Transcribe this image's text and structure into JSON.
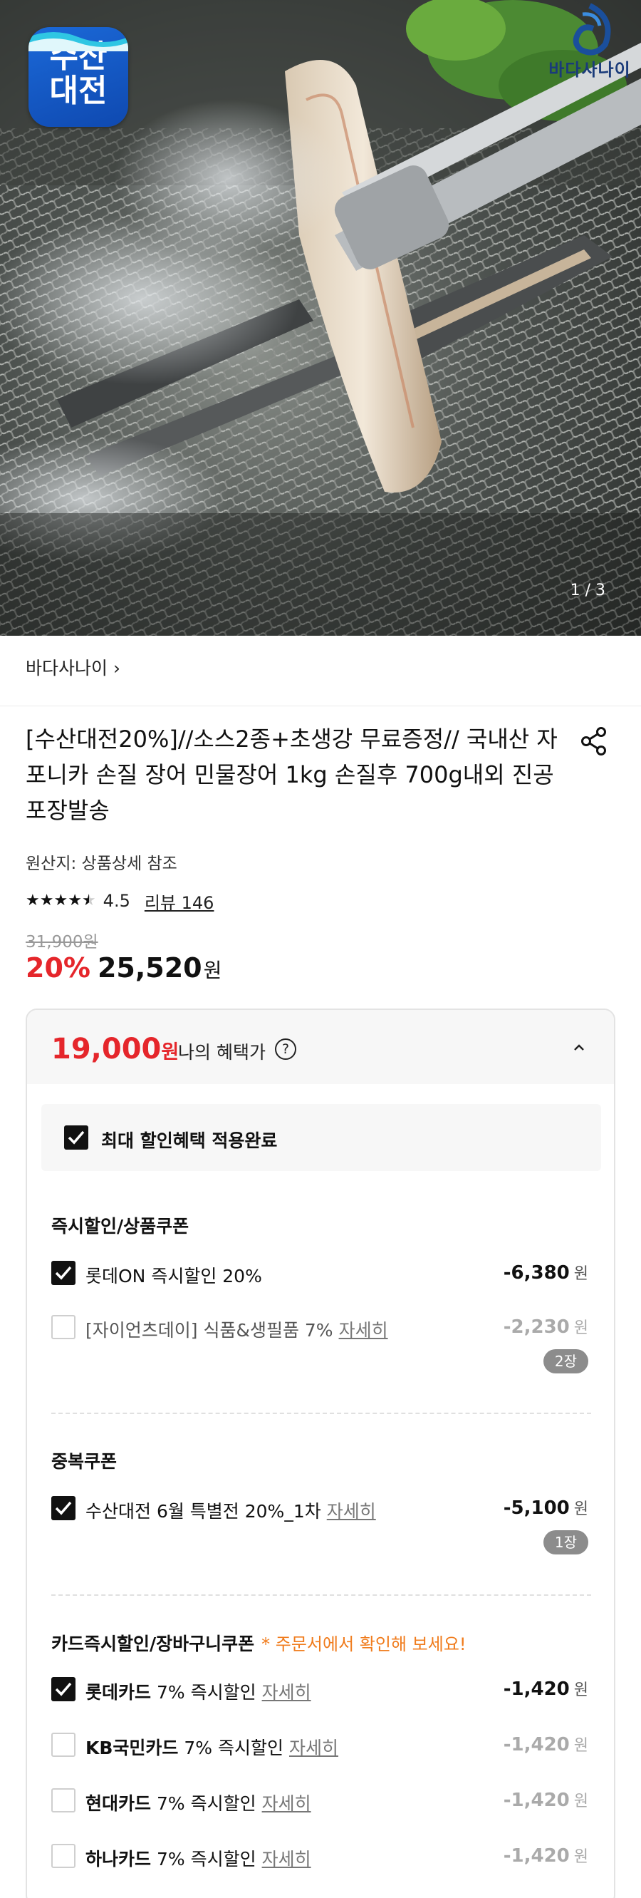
{
  "hero": {
    "badge_line1": "수산",
    "badge_line2": "대전",
    "brand": "바다사나이",
    "page_indicator": "1 / 3"
  },
  "seller": {
    "name": "바다사나이 ›"
  },
  "product": {
    "title": "[수산대전20%]//소스2종+초생강 무료증정// 국내산 자포니카 손질 장어 민물장어 1kg 손질후 700g내외 진공포장발송",
    "origin": "원산지: 상품상세 참조",
    "rating_stars": 4.5,
    "rating": "4.5",
    "review": "리뷰 146",
    "original_price": "31,900원",
    "discount": "20%",
    "price": "25,520",
    "price_unit": "원"
  },
  "benefit": {
    "price": "19,000",
    "price_unit": "원",
    "label": "나의 혜택가",
    "help": "?",
    "max_applied": "최대 할인혜택 적용완료",
    "sections": {
      "instant": {
        "title": "즉시할인/상품쿠폰",
        "rows": [
          {
            "label": "롯데ON 즉시할인 20%",
            "detail": "",
            "amount": "-6,380",
            "unit": "원",
            "checked": true
          },
          {
            "label": "[자이언츠데이] 식품&생필품 7%",
            "detail": "자세히",
            "amount": "-2,230",
            "unit": "원",
            "checked": false,
            "chip": "2장"
          }
        ]
      },
      "dup": {
        "title": "중복쿠폰",
        "rows": [
          {
            "label": "수산대전 6월 특별전 20%_1차",
            "detail": "자세히",
            "amount": "-5,100",
            "unit": "원",
            "checked": true,
            "chip": "1장"
          }
        ]
      },
      "card": {
        "title": "카드즉시할인/장바구니쿠폰",
        "note": "* 주문서에서 확인해 보세요!",
        "rows": [
          {
            "brand": "롯데카드",
            "label": "7% 즉시할인",
            "detail": "자세히",
            "amount": "-1,420",
            "unit": "원",
            "checked": true
          },
          {
            "brand": "KB국민카드",
            "label": "7% 즉시할인",
            "detail": "자세히",
            "amount": "-1,420",
            "unit": "원",
            "checked": false
          },
          {
            "brand": "현대카드",
            "label": "7% 즉시할인",
            "detail": "자세히",
            "amount": "-1,420",
            "unit": "원",
            "checked": false
          },
          {
            "brand": "하나카드",
            "label": "7% 즉시할인",
            "detail": "자세히",
            "amount": "-1,420",
            "unit": "원",
            "checked": false
          }
        ]
      }
    }
  },
  "colors": {
    "accent_red": "#e5262b",
    "note_orange": "#f07c1d",
    "badge_blue": "#1b69d8"
  },
  "icons": [
    "share-icon",
    "help-icon",
    "chevron-up-icon",
    "checkbox-icon",
    "star-icon"
  ]
}
